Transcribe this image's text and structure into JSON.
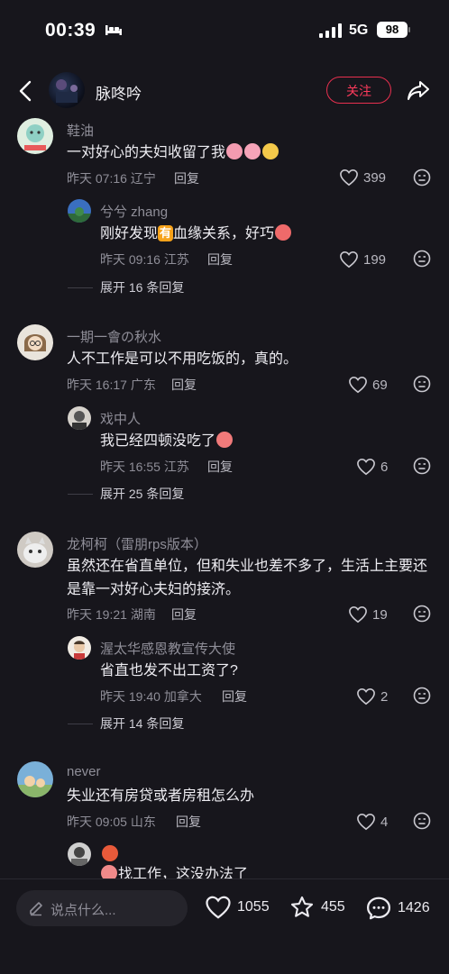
{
  "status": {
    "time": "00:39",
    "network": "5G",
    "battery": "98"
  },
  "nav": {
    "title": "脉咚吟",
    "follow_label": "关注"
  },
  "comments": [
    {
      "name": "鞋油",
      "text": "一对好心的夫妇收留了我",
      "time": "昨天 07:16 辽宁",
      "reply_label": "回复",
      "likes": "399",
      "reply": {
        "name": "兮兮 zhang",
        "text_a": "刚好发现",
        "badge": "有",
        "text_b": "血缘关系，好巧",
        "time": "昨天 09:16 江苏",
        "reply_label": "回复",
        "likes": "199"
      },
      "expand": "展开 16 条回复"
    },
    {
      "name": "一期一會の秋水",
      "text": "人不工作是可以不用吃饭的，真的。",
      "time": "昨天 16:17 广东",
      "reply_label": "回复",
      "likes": "69",
      "reply": {
        "name": "戏中人",
        "text": "我已经四顿没吃了",
        "time": "昨天 16:55 江苏",
        "reply_label": "回复",
        "likes": "6"
      },
      "expand": "展开 25 条回复"
    },
    {
      "name": "龙柯柯（雷朋rps版本）",
      "text_line1": "虽然还在省直单位，但和失业也差不多了，生活上主要还",
      "text_line2": "是靠一对好心夫妇的接济。",
      "time": "昨天 19:21 湖南",
      "reply_label": "回复",
      "likes": "19",
      "reply": {
        "name": "渥太华感恩教宣传大使",
        "text": "省直也发不出工资了?",
        "time": "昨天 19:40 加拿大",
        "reply_label": "回复",
        "likes": "2"
      },
      "expand": "展开 14 条回复"
    },
    {
      "name": "never",
      "text": "失业还有房贷或者房租怎么办",
      "time": "昨天 09:05 山东",
      "reply_label": "回复",
      "likes": "4",
      "reply": {
        "text": "找工作，这没办法了"
      }
    }
  ],
  "bottom": {
    "placeholder": "说点什么...",
    "likes": "1055",
    "stars": "455",
    "comments": "1426"
  },
  "colors": {
    "background": "#17161c",
    "accent": "#ff3b5c",
    "secondary_text": "#8f8e98"
  },
  "icons": [
    "back-arrow-icon",
    "share-arrow-icon",
    "heart-icon",
    "meh-face-icon",
    "pencil-icon",
    "star-icon",
    "chat-bubble-icon"
  ]
}
